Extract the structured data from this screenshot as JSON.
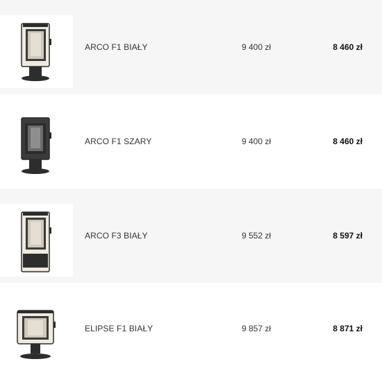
{
  "products": [
    {
      "name": "ARCO F1 BIAŁY",
      "old_price": "9 400 zł",
      "new_price": "8 460 zł",
      "image_icon": "stove-white-tall-icon",
      "body_color": "#efeae0"
    },
    {
      "name": "ARCO F1 SZARY",
      "old_price": "9 400 zł",
      "new_price": "8 460 zł",
      "image_icon": "stove-grey-tall-icon",
      "body_color": "#3a3b3d"
    },
    {
      "name": "ARCO F3 BIAŁY",
      "old_price": "9 552 zł",
      "new_price": "8 597 zł",
      "image_icon": "stove-white-tall-icon",
      "body_color": "#efeae0"
    },
    {
      "name": "ELIPSE F1 BIAŁY",
      "old_price": "9 857 zł",
      "new_price": "8 871 zł",
      "image_icon": "stove-white-wide-icon",
      "body_color": "#efeae0"
    }
  ]
}
